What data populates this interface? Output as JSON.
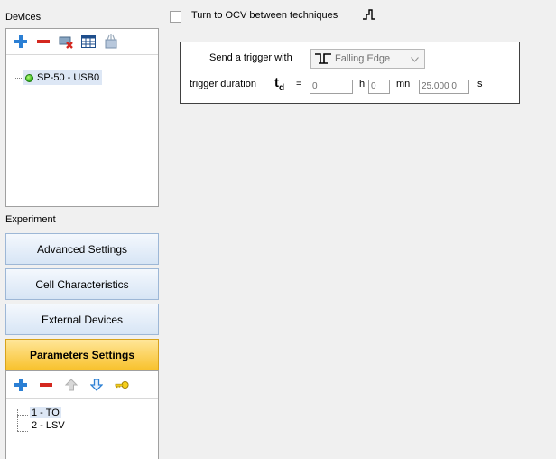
{
  "devices": {
    "label": "Devices",
    "toolbar": [
      "add-icon",
      "remove-icon",
      "disconnect-icon",
      "table-icon",
      "settings-icon"
    ],
    "items": [
      {
        "label": "SP-50 - USB0",
        "status": "connected"
      }
    ]
  },
  "experiment": {
    "label": "Experiment",
    "nav": [
      {
        "label": "Advanced Settings"
      },
      {
        "label": "Cell Characteristics"
      },
      {
        "label": "External Devices"
      },
      {
        "label": "Parameters Settings",
        "active": true
      }
    ],
    "toolbar": [
      "add-icon",
      "remove-icon",
      "move-up-icon",
      "move-down-icon",
      "key-icon"
    ],
    "techniques": [
      {
        "label": "1 - TO",
        "selected": true
      },
      {
        "label": "2 - LSV",
        "selected": false
      }
    ]
  },
  "ocv": {
    "label": "Turn to OCV between techniques",
    "checked": false
  },
  "trigger": {
    "send_label": "Send a trigger with",
    "edge_value": "Falling Edge",
    "duration_label": "trigger duration",
    "td_symbol": "t",
    "td_sub": "d",
    "equals": "=",
    "hours": "0",
    "h_unit": "h",
    "minutes": "0",
    "mn_unit": "mn",
    "seconds": "25.000 0",
    "s_unit": "s"
  },
  "colors": {
    "active_tab": "#f8c22e",
    "tab": "#d7e5f5",
    "selection": "#dde7f5"
  }
}
